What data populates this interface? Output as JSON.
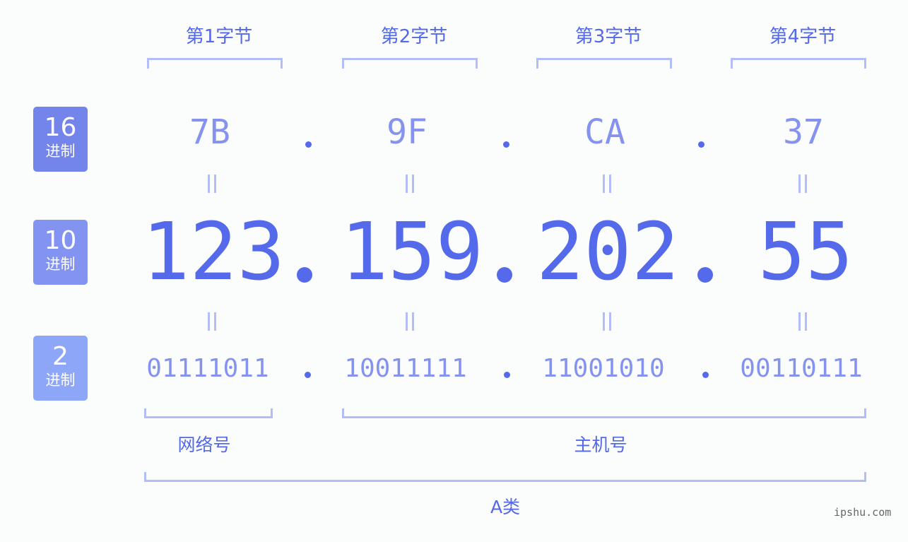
{
  "bytes": {
    "labels": [
      "第1字节",
      "第2字节",
      "第3字节",
      "第4字节"
    ]
  },
  "badges": [
    {
      "num": "16",
      "sub": "进制",
      "color": "#7384ea"
    },
    {
      "num": "10",
      "sub": "进制",
      "color": "#8293f1"
    },
    {
      "num": "2",
      "sub": "进制",
      "color": "#8ea6f8"
    }
  ],
  "hex": [
    "7B",
    "9F",
    "CA",
    "37"
  ],
  "decimal": [
    "123",
    "159",
    "202",
    "55"
  ],
  "binary": [
    "01111011",
    "10011111",
    "11001010",
    "00110111"
  ],
  "separator": ".",
  "parts": {
    "network": "网络号",
    "host": "主机号",
    "class": "A类"
  },
  "watermark": "ipshu.com",
  "colors": {
    "accent": "#556aeb",
    "light": "#8593ee",
    "bracket": "#b3bdf7"
  }
}
